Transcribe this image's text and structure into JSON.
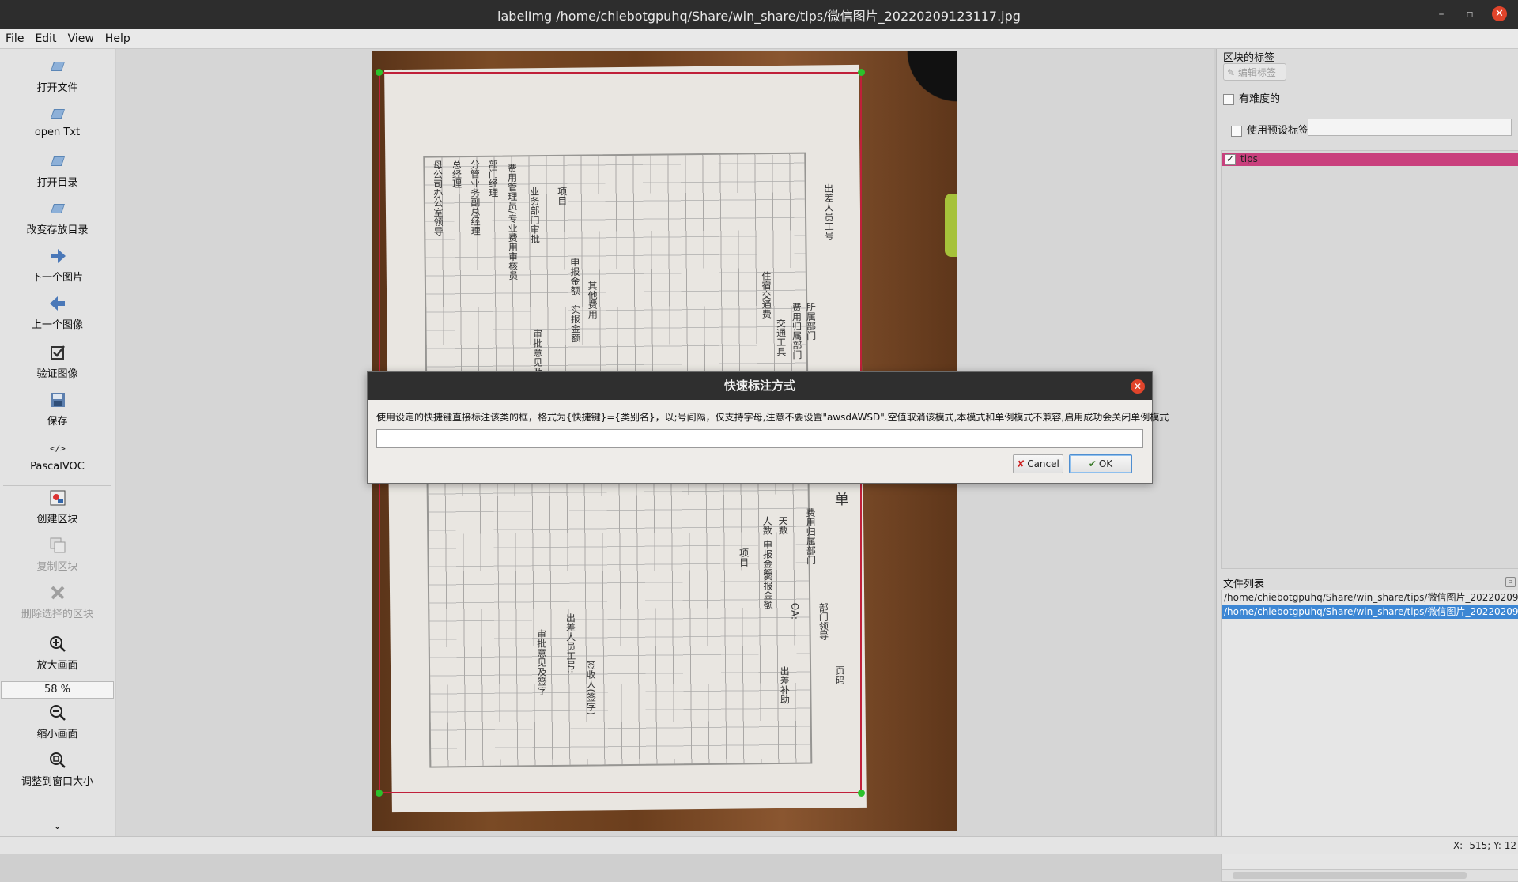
{
  "window": {
    "title": "labelImg /home/chiebotgpuhq/Share/win_share/tips/微信图片_20220209123117.jpg",
    "minimize_glyph": "–",
    "restore_glyph": "▫",
    "close_glyph": "✕"
  },
  "menu": [
    "File",
    "Edit",
    "View",
    "Help"
  ],
  "toolbar": {
    "tools": [
      {
        "label": "打开文件",
        "icon": "folder-open-icon",
        "enabled": true
      },
      {
        "label": "open Txt",
        "icon": "folder-open-icon",
        "enabled": true
      },
      {
        "label": "打开目录",
        "icon": "folder-open-icon",
        "enabled": true
      },
      {
        "label": "改变存放目录",
        "icon": "folder-open-icon",
        "enabled": true
      },
      {
        "label": "下一个图片",
        "icon": "arrow-right-icon",
        "enabled": true
      },
      {
        "label": "上一个图像",
        "icon": "arrow-left-icon",
        "enabled": true
      },
      {
        "label": "验证图像",
        "icon": "checkbox-icon",
        "enabled": true
      },
      {
        "label": "保存",
        "icon": "save-icon",
        "enabled": true
      },
      {
        "label": "PascalVOC",
        "icon": "code-icon",
        "enabled": true
      },
      {
        "label": "创建区块",
        "icon": "create-box-icon",
        "enabled": true
      },
      {
        "label": "复制区块",
        "icon": "copy-box-icon",
        "enabled": false
      },
      {
        "label": "删除选择的区块",
        "icon": "delete-icon",
        "enabled": false
      },
      {
        "label": "放大画面",
        "icon": "zoom-in-icon",
        "enabled": true
      },
      {
        "label": "缩小画面",
        "icon": "zoom-out-icon",
        "enabled": true
      },
      {
        "label": "调整到窗口大小",
        "icon": "fit-window-icon",
        "enabled": true
      }
    ],
    "zoom_value": "58 %",
    "more_glyph": "⌄"
  },
  "right_panel": {
    "box_labels_title": "区块的标签",
    "edit_label_button": "编辑标签",
    "difficult_label": "有难度的",
    "difficult_checked": false,
    "use_default_label": "使用预设标签",
    "use_default_checked": false,
    "default_label_value": "",
    "labels": [
      {
        "name": "tips",
        "checked": true,
        "color": "#c9407d"
      }
    ],
    "file_list_title": "文件列表",
    "files": [
      {
        "path": "/home/chiebotgpuhq/Share/win_share/tips/微信图片_20220209123116.jpg",
        "selected": false
      },
      {
        "path": "/home/chiebotgpuhq/Share/win_share/tips/微信图片_20220209123117.jpg",
        "selected": true
      }
    ]
  },
  "status": {
    "coords": "X: -515; Y: 12"
  },
  "dialog": {
    "title": "快速标注方式",
    "message": "使用设定的快捷键直接标注该类的框，格式为{快捷键}={类别名}，以;号间隔，仅支持字母,注意不要设置\"awsdAWSD\".空值取消该模式,本模式和单例模式不兼容,启用成功会关闭单例模式",
    "input_value": "",
    "cancel_label": "Cancel",
    "ok_label": "OK"
  },
  "document_text": {
    "col1": "母公司办公室领导",
    "col2": "总经理",
    "col3": "分管业务副总经理",
    "col4": "部门经理",
    "col5": "费用管理员/专业费用审核员",
    "col6": "业务部门审批",
    "col7": "项目",
    "col8": "申报金额",
    "col9": "实报金额",
    "col10": "审批意见及签字",
    "col11": "其他费用",
    "col12": "出差人员工号",
    "col13": "所属部门",
    "col14": "费用归属部门",
    "col15": "交通工具",
    "col16": "住宿交通费",
    "col17": "出差人员工号:",
    "col18": "部门领导",
    "col19": "审批意见及签字",
    "col20": "签收人(签字)",
    "col21": "OA:",
    "col22": "实报金额",
    "col23": "申报金额",
    "col24": "人数",
    "col25": "天数",
    "col26": "项目",
    "col27": "单",
    "col28": "费用归属部门",
    "col29": "出差补助",
    "col30": "页码"
  }
}
